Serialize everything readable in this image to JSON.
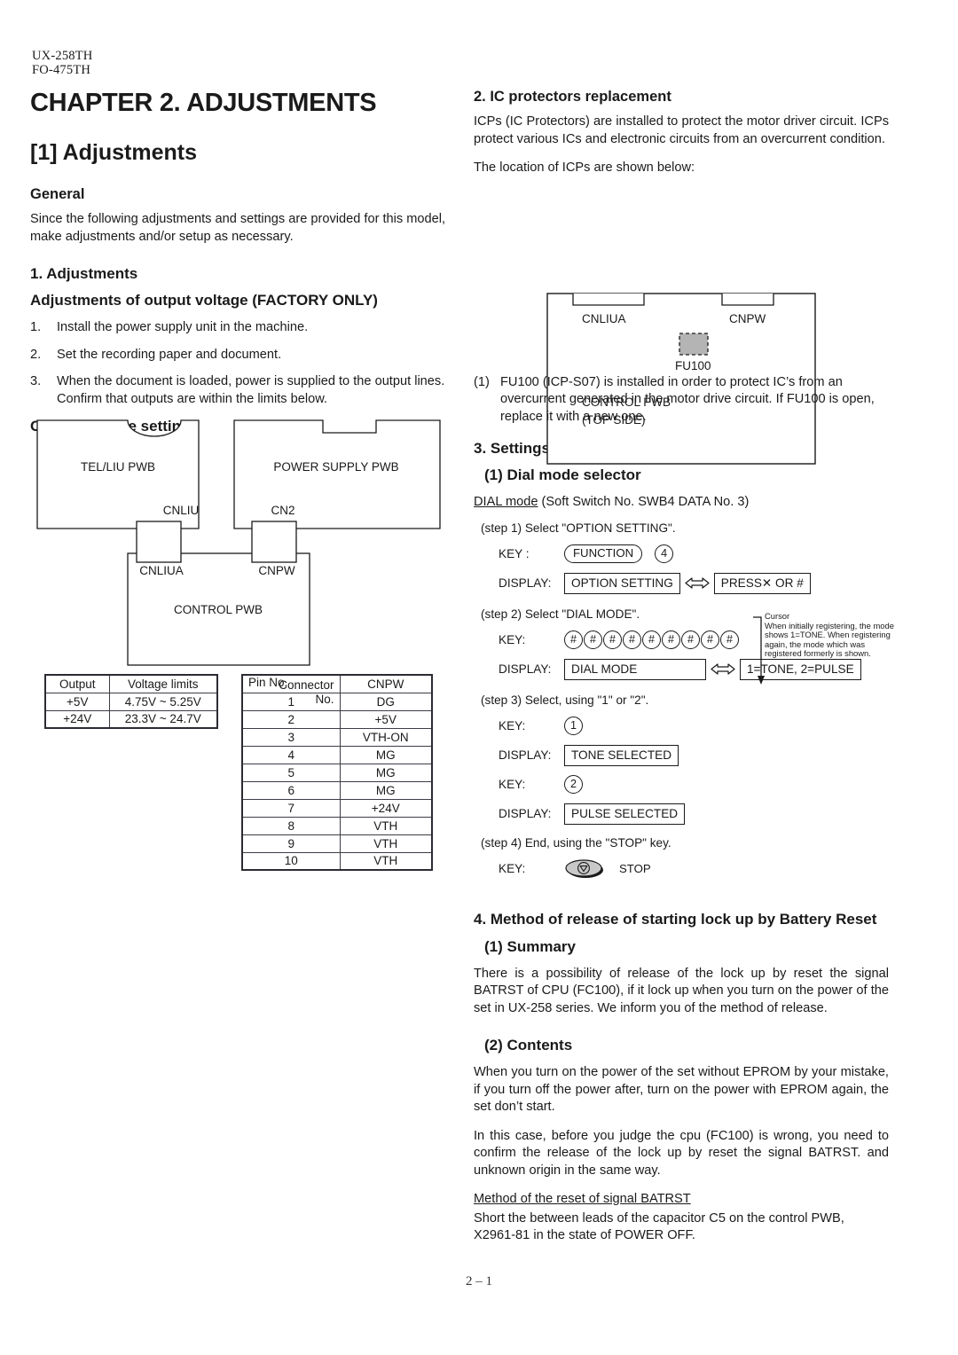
{
  "header": {
    "model_1": "UX-258TH",
    "model_2": "FO-475TH",
    "chapter_title": "CHAPTER 2. ADJUSTMENTS",
    "section_title": "[1] Adjustments"
  },
  "left": {
    "general_heading": "General",
    "general_text": "Since the following adjustments and settings are provided for this model, make adjustments and/or setup as necessary.",
    "adjustments_heading": "1. Adjustments",
    "factory_heading": "Adjustments of output voltage (FACTORY ONLY)",
    "steps": [
      {
        "n": "1.",
        "text": "Install the power supply unit in the machine."
      },
      {
        "n": "2.",
        "text": "Set the recording paper and document."
      },
      {
        "n": "3.",
        "text": "When the document is loaded, power is supplied to the output lines. Confirm that outputs are within the limits below."
      }
    ],
    "output_voltage_heading": "Output voltage settings",
    "diagram": {
      "tel_liu_pwb": "TEL/LIU PWB",
      "power_supply_pwb": "POWER SUPPLY PWB",
      "cnliu": "CNLIU",
      "cn2": "CN2",
      "cnliua": "CNLIUA",
      "cnpw": "CNPW",
      "control_pwb": "CONTROL PWB"
    },
    "voltage_table": {
      "headers": [
        "Output",
        "Voltage limits"
      ],
      "rows": [
        [
          "+5V",
          "4.75V ~ 5.25V"
        ],
        [
          "+24V",
          "23.3V ~ 24.7V"
        ]
      ]
    },
    "connector_table": {
      "header_connector_no": "Connector",
      "header_no": "No.",
      "header_pin_no": "Pin No.",
      "header_cnpw": "CNPW",
      "rows": [
        [
          "1",
          "DG"
        ],
        [
          "2",
          "+5V"
        ],
        [
          "3",
          "VTH-ON"
        ],
        [
          "4",
          "MG"
        ],
        [
          "5",
          "MG"
        ],
        [
          "6",
          "MG"
        ],
        [
          "7",
          "+24V"
        ],
        [
          "8",
          "VTH"
        ],
        [
          "9",
          "VTH"
        ],
        [
          "10",
          "VTH"
        ]
      ]
    }
  },
  "right": {
    "icp_heading": "2. IC protectors replacement",
    "icp_p1": "ICPs (IC Protectors) are installed to protect the motor driver circuit. ICPs protect various ICs and electronic circuits from an overcurrent condition.",
    "icp_p2": "The location of ICPs are shown below:",
    "icp_diagram": {
      "cnliua": "CNLIUA",
      "cnpw": "CNPW",
      "fu100": "FU100",
      "control_pwb": "CONTROL PWB",
      "top_side": "(TOP SIDE)"
    },
    "icp_note_n": "(1)",
    "icp_note_text": "FU100 (ICP-S07) is installed in order to protect IC’s from an overcurrent generated in the motor drive circuit. If FU100 is open, replace it with a new one.",
    "settings_heading": "3. Settings",
    "dial_mode_heading": "(1) Dial mode selector",
    "dial_mode_line_underlined": "DIAL mode",
    "dial_mode_line_rest": " (Soft Switch No. SWB4 DATA No. 3)",
    "step1": {
      "text": "(step 1) Select \"OPTION SETTING\".",
      "key_label": "KEY :",
      "key_function": "FUNCTION",
      "key_digit": "4",
      "display_label": "DISPLAY:",
      "display_1": "OPTION SETTING",
      "display_2": "PRESS✕ OR #"
    },
    "step2": {
      "text": "(step 2) Select \"DIAL MODE\".",
      "key_label": "KEY:",
      "keys": [
        "#",
        "#",
        "#",
        "#",
        "#",
        "#",
        "#",
        "#",
        "#"
      ],
      "display_label": "DISPLAY:",
      "display_1": "DIAL MODE",
      "display_2": "1=TONE, 2=PULSE"
    },
    "cursor_note": {
      "title": "Cursor",
      "text": "When initially registering, the mode shows 1=TONE. When registering again, the mode which was registered formerly is shown."
    },
    "step3": {
      "text": "(step 3) Select, using \"1\" or \"2\".",
      "key_label_a": "KEY:",
      "key_a": "1",
      "display_label_a": "DISPLAY:",
      "display_a": "TONE SELECTED",
      "key_label_b": "KEY:",
      "key_b": "2",
      "display_label_b": "DISPLAY:",
      "display_b": "PULSE SELECTED"
    },
    "step4": {
      "text": "(step 4) End, using the \"STOP\" key.",
      "key_label": "KEY:",
      "stop_label": "STOP"
    },
    "battery_heading": "4. Method of release of starting lock up by Battery Reset",
    "summary_heading": "(1) Summary",
    "summary_text": "There is a possibility of release of the lock up by reset the signal BATRST of CPU (FC100), if it lock up when you turn on the power of the set in UX-258 series. We inform you of the method of release.",
    "contents_heading": "(2) Contents",
    "contents_p1": "When you turn on the power of the set without EPROM by your mistake, if you turn off the power after, turn on the power with EPROM again, the set don’t start.",
    "contents_p2": "In this case, before you judge the cpu (FC100) is wrong, you need to confirm the release of the lock up by reset the signal BATRST. and unknown origin in the same way.",
    "method_heading": "Method of the reset of signal BATRST",
    "method_text": "Short the between leads of the capacitor C5 on the control PWB, X2961-81 in the state of POWER OFF."
  },
  "footer": {
    "page_number": "2 – 1"
  },
  "colors": {
    "ink": "#1a1a1a",
    "rule": "#3c3c46",
    "fu100_fill": "#b4b4b4"
  }
}
